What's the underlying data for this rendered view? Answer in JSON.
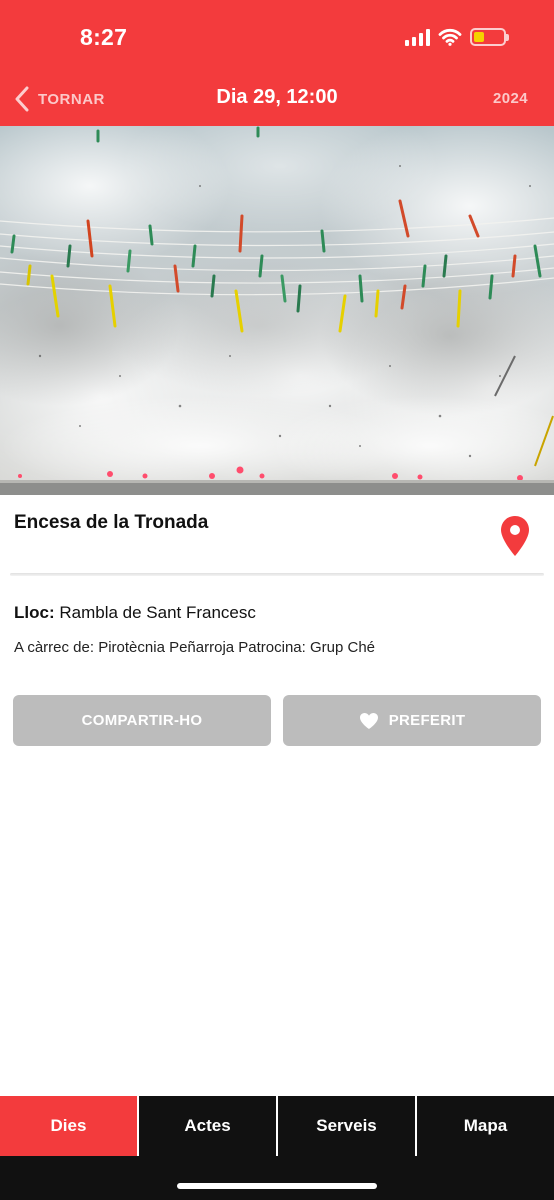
{
  "status_bar": {
    "time": "8:27",
    "icons": [
      "signal-icon",
      "wifi-icon",
      "battery-low-icon"
    ]
  },
  "nav": {
    "back_label": "TORNAR",
    "title": "Dia 29, 12:00",
    "year": "2024"
  },
  "event": {
    "title": "Encesa de la Tronada",
    "place_label": "Lloc:",
    "place_value": "Rambla de Sant Francesc",
    "organizer": "A càrrec de: Pirotècnia Peñarroja Patrocina: Grup Ché"
  },
  "actions": {
    "share_label": "COMPARTIR-HO",
    "favorite_label": "PREFERIT"
  },
  "tabs": [
    {
      "label": "Dies",
      "active": true
    },
    {
      "label": "Actes",
      "active": false
    },
    {
      "label": "Serveis",
      "active": false
    },
    {
      "label": "Mapa",
      "active": false
    }
  ],
  "colors": {
    "brand_red": "#f33b3d",
    "button_gray": "#bcbcbc",
    "tabbar_black": "#111111"
  }
}
